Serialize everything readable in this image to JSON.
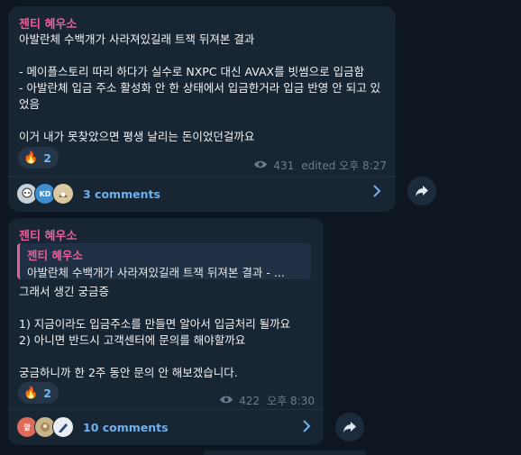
{
  "colors": {
    "background": "#0e1621",
    "bubble": "#182533",
    "author": "#e8609a",
    "link": "#6fb1ee"
  },
  "messages": [
    {
      "author": "젠티 혜우소",
      "text": "아발란체 수백개가 사라져있길래 트잭 뒤져본 결과\n\n- 메이플스토리 따리 하다가 실수로 NXPC 대신 AVAX를 빗썸으로 입금함\n- 아발란체 입금 주소 활성화 안 한 상태에서 입금한거라 입금 반영 안 되고 있었음\n\n이거 내가 못찾았으면 평생 날리는 돈이었던걸까요",
      "reaction": {
        "emoji": "🔥",
        "count": "2"
      },
      "views": "431",
      "time": "edited 오후 8:27",
      "avatar_label": "KD",
      "comments": "3 comments"
    },
    {
      "author": "젠티 혜우소",
      "reply": {
        "author": "젠티 혜우소",
        "text": "아발란체 수백개가 사라져있길래 트잭 뒤져본 결과  - ..."
      },
      "text": "그래서 생긴 궁금증\n\n1) 지금이라도 입금주소를 만들면 알아서 입금처리 될까요\n2) 아니면 반드시 고객센터에 문의를 해야할까요\n\n궁금하니까 한 2주 동안 문의 안 해보겠습니다.",
      "reaction": {
        "emoji": "🔥",
        "count": "2"
      },
      "views": "422",
      "time": "오후 8:30",
      "avatar_label": "앝",
      "comments": "10 comments"
    }
  ]
}
